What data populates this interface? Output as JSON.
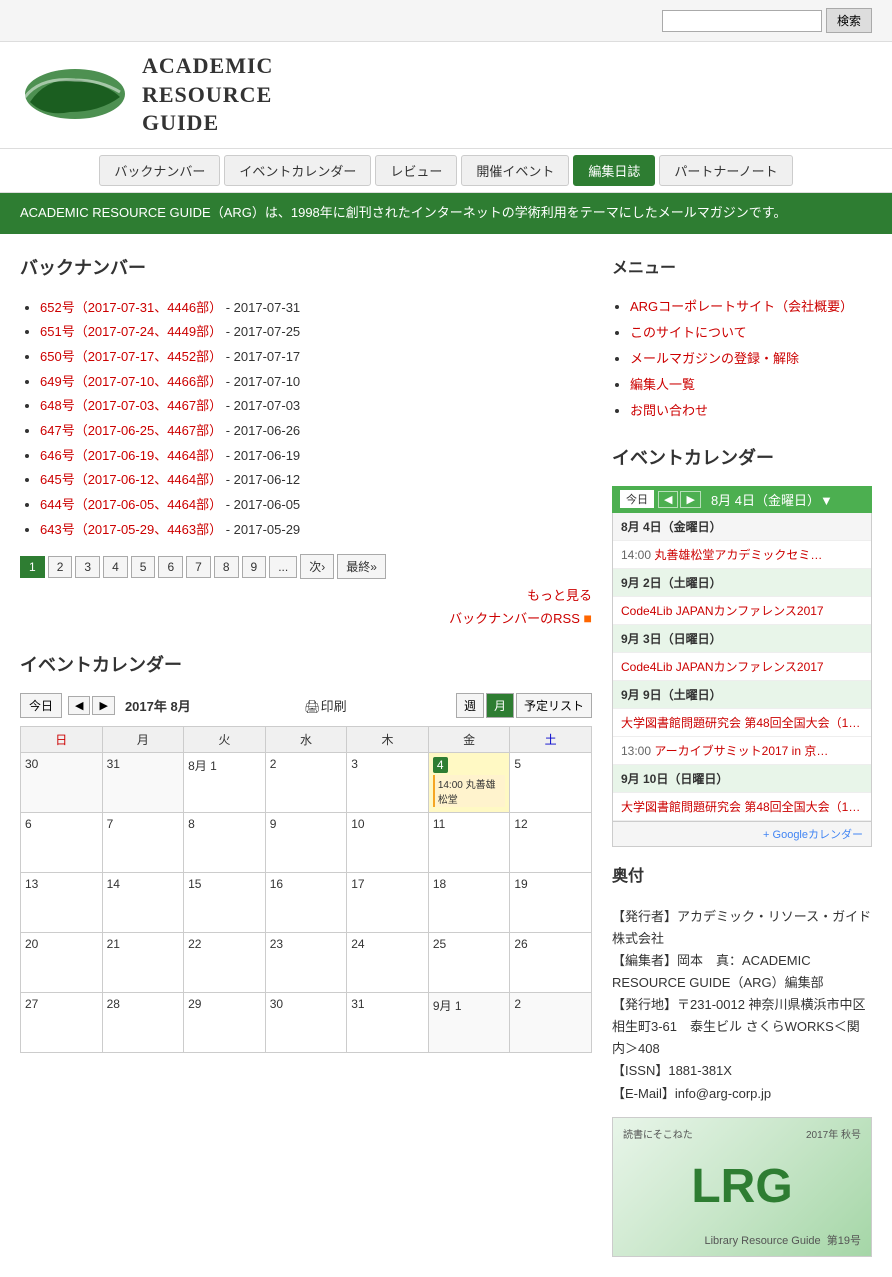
{
  "search": {
    "placeholder": "",
    "button_label": "検索"
  },
  "logo": {
    "text_line1": "Academic",
    "text_line2": "Resource",
    "text_line3": "Guide"
  },
  "nav": {
    "items": [
      {
        "label": "バックナンバー",
        "active": false
      },
      {
        "label": "イベントカレンダー",
        "active": false
      },
      {
        "label": "レビュー",
        "active": false
      },
      {
        "label": "開催イベント",
        "active": false
      },
      {
        "label": "編集日誌",
        "active": true
      },
      {
        "label": "パートナーノート",
        "active": false
      }
    ]
  },
  "hero": {
    "text": "ACADEMIC RESOURCE GUIDE（ARG）は、1998年に創刊されたインターネットの学術利用をテーマにしたメールマガジンです。"
  },
  "backnumber": {
    "section_title": "バックナンバー",
    "items": [
      {
        "label": "652号（2017-07-31、4446部）",
        "date": " - 2017-07-31"
      },
      {
        "label": "651号（2017-07-24、4449部）",
        "date": " - 2017-07-25"
      },
      {
        "label": "650号（2017-07-17、4452部）",
        "date": " - 2017-07-17"
      },
      {
        "label": "649号（2017-07-10、4466部）",
        "date": " - 2017-07-10"
      },
      {
        "label": "648号（2017-07-03、4467部）",
        "date": " - 2017-07-03"
      },
      {
        "label": "647号（2017-06-25、4467部）",
        "date": " - 2017-06-26"
      },
      {
        "label": "646号（2017-06-19、4464部）",
        "date": " - 2017-06-19"
      },
      {
        "label": "645号（2017-06-12、4464部）",
        "date": " - 2017-06-12"
      },
      {
        "label": "644号（2017-06-05、4464部）",
        "date": " - 2017-06-05"
      },
      {
        "label": "643号（2017-05-29、4463部）",
        "date": " - 2017-05-29"
      }
    ],
    "pagination": [
      "1",
      "2",
      "3",
      "4",
      "5",
      "6",
      "7",
      "8",
      "9",
      "...",
      "次›",
      "最終»"
    ],
    "more_link": "もっと見る",
    "rss_link": "バックナンバーのRSS"
  },
  "event_calendar_left": {
    "section_title": "イベントカレンダー",
    "today_btn": "今日",
    "month_label": "2017年 8月",
    "view_week": "週",
    "view_month": "月",
    "view_list": "予定リスト",
    "weekdays": [
      "日",
      "月",
      "火",
      "水",
      "木",
      "金",
      "土"
    ],
    "rows": [
      [
        {
          "day": "30",
          "other": true,
          "event": null
        },
        {
          "day": "31",
          "other": true,
          "event": null
        },
        {
          "day": "8月 1",
          "other": false,
          "event": null
        },
        {
          "day": "2",
          "other": false,
          "event": null
        },
        {
          "day": "3",
          "other": false,
          "event": null
        },
        {
          "day": "4",
          "other": false,
          "today": true,
          "event": "14:00 丸善雄松堂"
        },
        {
          "day": "5",
          "other": false,
          "event": null
        }
      ],
      [
        {
          "day": "6",
          "other": false,
          "event": null
        },
        {
          "day": "7",
          "other": false,
          "event": null
        },
        {
          "day": "8",
          "other": false,
          "event": null
        },
        {
          "day": "9",
          "other": false,
          "event": null
        },
        {
          "day": "10",
          "other": false,
          "event": null
        },
        {
          "day": "11",
          "other": false,
          "event": null
        },
        {
          "day": "12",
          "other": false,
          "event": null
        }
      ],
      [
        {
          "day": "13",
          "other": false,
          "event": null
        },
        {
          "day": "14",
          "other": false,
          "event": null
        },
        {
          "day": "15",
          "other": false,
          "event": null
        },
        {
          "day": "16",
          "other": false,
          "event": null
        },
        {
          "day": "17",
          "other": false,
          "event": null
        },
        {
          "day": "18",
          "other": false,
          "event": null
        },
        {
          "day": "19",
          "other": false,
          "event": null
        }
      ],
      [
        {
          "day": "20",
          "other": false,
          "event": null
        },
        {
          "day": "21",
          "other": false,
          "event": null
        },
        {
          "day": "22",
          "other": false,
          "event": null
        },
        {
          "day": "23",
          "other": false,
          "event": null
        },
        {
          "day": "24",
          "other": false,
          "event": null
        },
        {
          "day": "25",
          "other": false,
          "event": null
        },
        {
          "day": "26",
          "other": false,
          "event": null
        }
      ],
      [
        {
          "day": "27",
          "other": false,
          "event": null
        },
        {
          "day": "28",
          "other": false,
          "event": null
        },
        {
          "day": "29",
          "other": false,
          "event": null
        },
        {
          "day": "30",
          "other": false,
          "event": null
        },
        {
          "day": "31",
          "other": false,
          "event": null
        },
        {
          "day": "9月 1",
          "other": true,
          "event": null
        },
        {
          "day": "2",
          "other": true,
          "event": null
        }
      ]
    ]
  },
  "menu_right": {
    "section_title": "メニュー",
    "items": [
      "ARGコーポレートサイト（会社概要）",
      "このサイトについて",
      "メールマガジンの登録・解除",
      "編集人一覧",
      "お問い合わせ"
    ]
  },
  "mini_calendar": {
    "section_title": "イベントカレンダー",
    "today_btn": "今日",
    "date_label": "8月 4日（金曜日）▼",
    "events": [
      {
        "type": "date",
        "label": "8月 4日（金曜日）",
        "weekend": false
      },
      {
        "type": "event",
        "time": "14:00",
        "title": "丸善雄松堂アカデミックセミ…"
      },
      {
        "type": "date",
        "label": "9月 2日（土曜日）",
        "weekend": true
      },
      {
        "type": "event",
        "time": "",
        "title": "Code4Lib JAPANカンファレンス2017"
      },
      {
        "type": "date",
        "label": "9月 3日（日曜日）",
        "weekend": true
      },
      {
        "type": "event",
        "time": "",
        "title": "Code4Lib JAPANカンファレンス2017"
      },
      {
        "type": "date",
        "label": "9月 9日（土曜日）",
        "weekend": true
      },
      {
        "type": "event",
        "time": "",
        "title": "大学図書館問題研究会 第48回全国大会（1…"
      },
      {
        "type": "event",
        "time": "13:00",
        "title": "アーカイブサミット2017 in 京…"
      },
      {
        "type": "date",
        "label": "9月 10日（日曜日）",
        "weekend": true
      },
      {
        "type": "event",
        "time": "",
        "title": "大学図書館問題研究会 第48回全国大会（1…"
      }
    ],
    "google_cal": "+ Googleカレンダー"
  },
  "okuzuke": {
    "section_title": "奥付",
    "lines": [
      "【発行者】アカデミック・リソース・ガイド株式会社",
      "【編集者】岡本　真：ACADEMIC RESOURCE GUIDE（ARG）編集部",
      "【発行地】〒231-0012 神奈川県横浜市中区相生町3-61　泰生ビル さくらWORKS＜関内＞408",
      "【ISSN】1881-381X",
      "【E-Mail】info@arg-corp.jp"
    ]
  },
  "lrg_image": {
    "main": "LRG",
    "top_label": "読書にそこねた",
    "issue_label": "2017年 秋号",
    "sub_label": "Library Resource Guide",
    "issue_num": "第19号"
  }
}
